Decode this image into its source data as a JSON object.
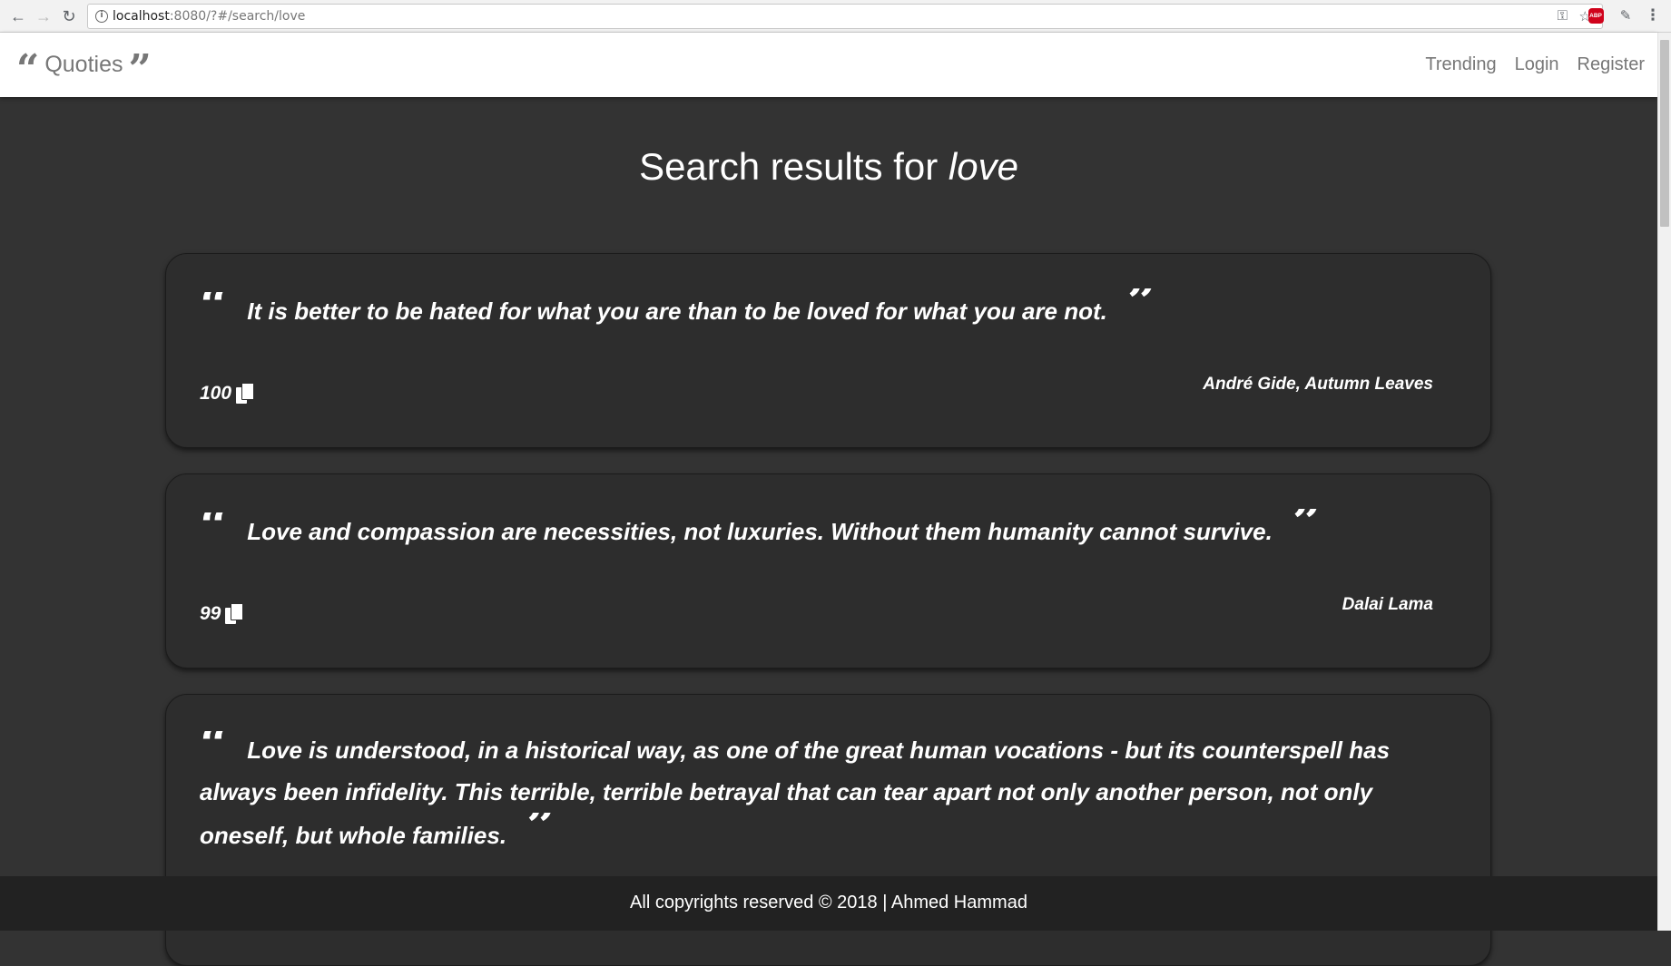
{
  "browser": {
    "url_host": "localhost",
    "url_rest": ":8080/?#/search/love",
    "back_icon": "←",
    "forward_icon": "→",
    "reload_icon": "↻",
    "info_icon": "i",
    "key_icon": "⚿",
    "star_icon": "☆",
    "abp_label": "ABP",
    "eyedropper_icon": "✎",
    "menu_icon": "⋮"
  },
  "navbar": {
    "brand": "Quoties",
    "open_quote_glyph": "“",
    "close_quote_glyph": "”",
    "links": [
      "Trending",
      "Login",
      "Register"
    ]
  },
  "search": {
    "prefix": "Search results for ",
    "term": "love"
  },
  "quotes": [
    {
      "text": "It is better to be hated for what you are than to be loved for what you are not.",
      "author": "André Gide, Autumn Leaves",
      "copies": "100"
    },
    {
      "text": "Love and compassion are necessities, not luxuries. Without them humanity cannot survive.",
      "author": "Dalai Lama",
      "copies": "99"
    },
    {
      "text": "Love is understood, in a historical way, as one of the great human vocations - but its counterspell has always been infidelity. This terrible, terrible betrayal that can tear apart not only another person, not only oneself, but whole families.",
      "author": "",
      "copies": ""
    }
  ],
  "footer": {
    "text": "All copyrights reserved © 2018 | Ahmed Hammad"
  },
  "colors": {
    "page_bg": "#333333",
    "card_bg": "#2d2d2d",
    "navbar_bg": "#ffffff",
    "footer_bg": "#222222",
    "nav_text": "#777777"
  }
}
